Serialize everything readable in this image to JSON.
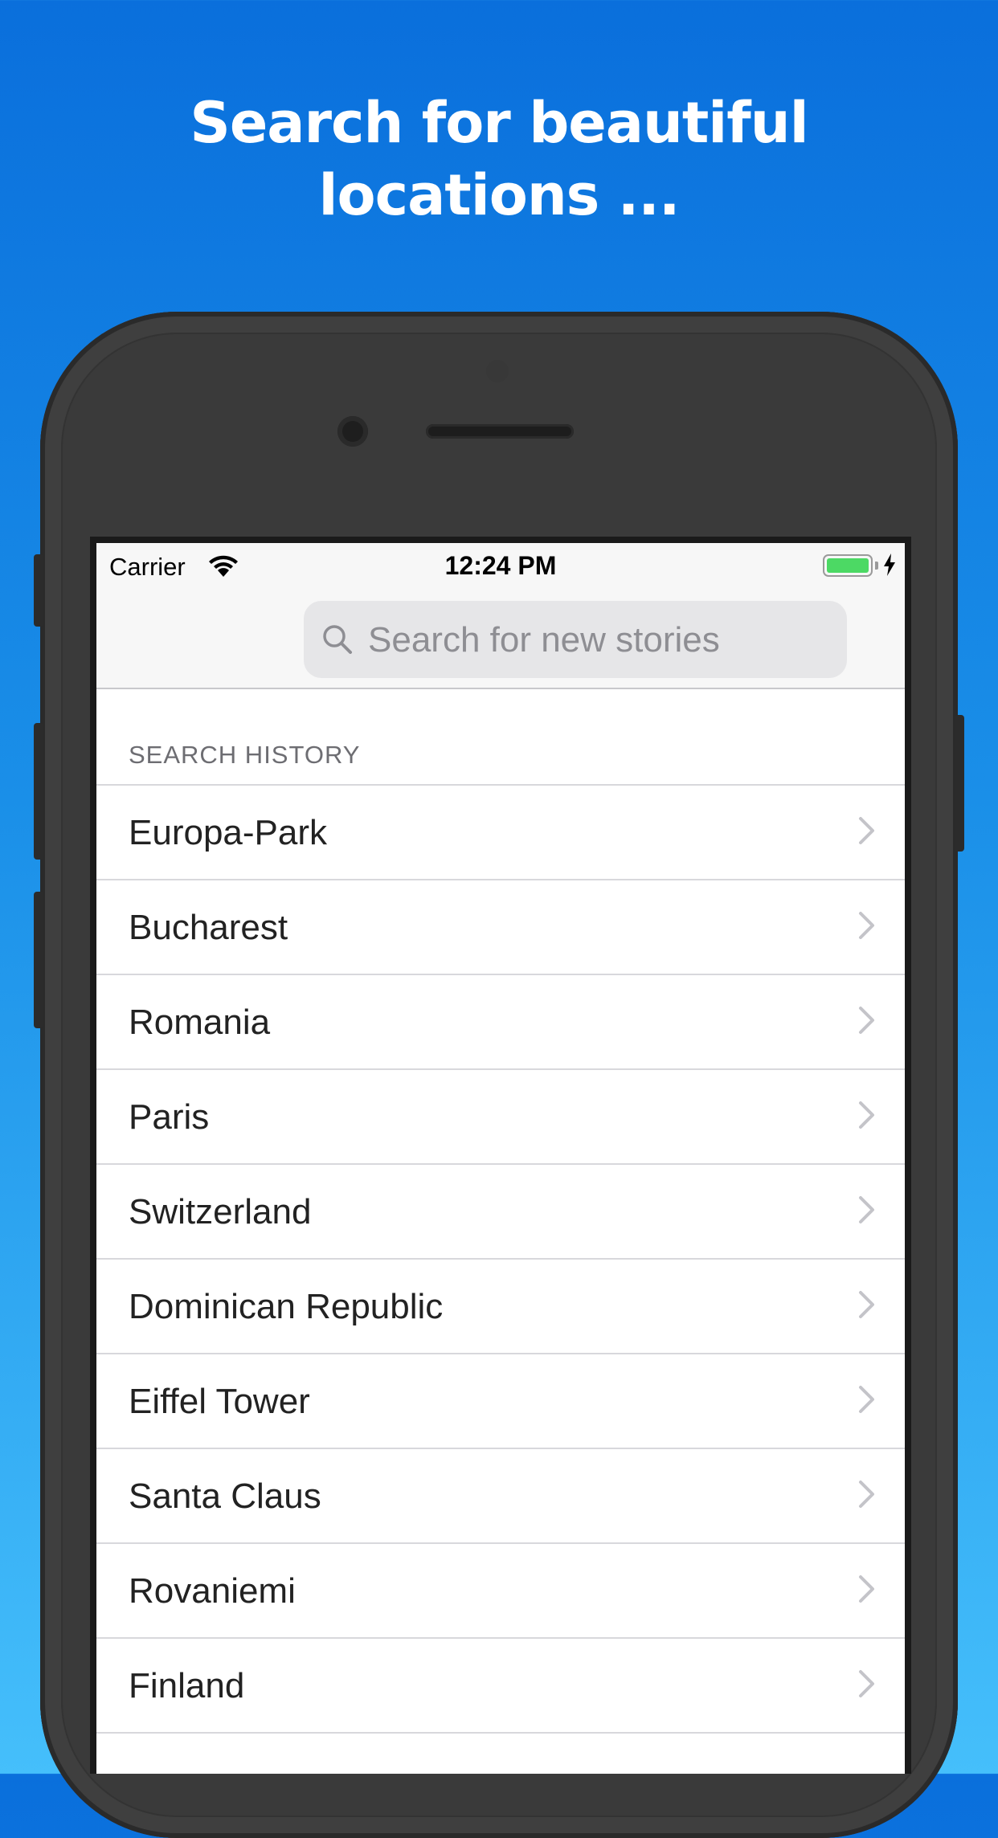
{
  "headline": {
    "line1": "Search for beautiful",
    "line2": "locations ..."
  },
  "status_bar": {
    "carrier": "Carrier",
    "time": "12:24 PM",
    "battery_level": 1.0,
    "battery_color": "#4cd964",
    "wifi_icon": "wifi-icon",
    "charging_icon": "bolt-icon"
  },
  "search": {
    "placeholder": "Search for new stories",
    "value": "",
    "icon": "search-icon"
  },
  "history": {
    "header": "SEARCH HISTORY",
    "items": [
      {
        "label": "Europa-Park"
      },
      {
        "label": "Bucharest"
      },
      {
        "label": "Romania"
      },
      {
        "label": "Paris"
      },
      {
        "label": "Switzerland"
      },
      {
        "label": "Dominican Republic"
      },
      {
        "label": "Eiffel Tower"
      },
      {
        "label": "Santa Claus"
      },
      {
        "label": "Rovaniemi"
      },
      {
        "label": "Finland"
      },
      {
        "label": ""
      }
    ]
  },
  "colors": {
    "background_top": "#0a6fdc",
    "background_bottom": "#45bffb",
    "phone_body": "#3a3a3a"
  }
}
